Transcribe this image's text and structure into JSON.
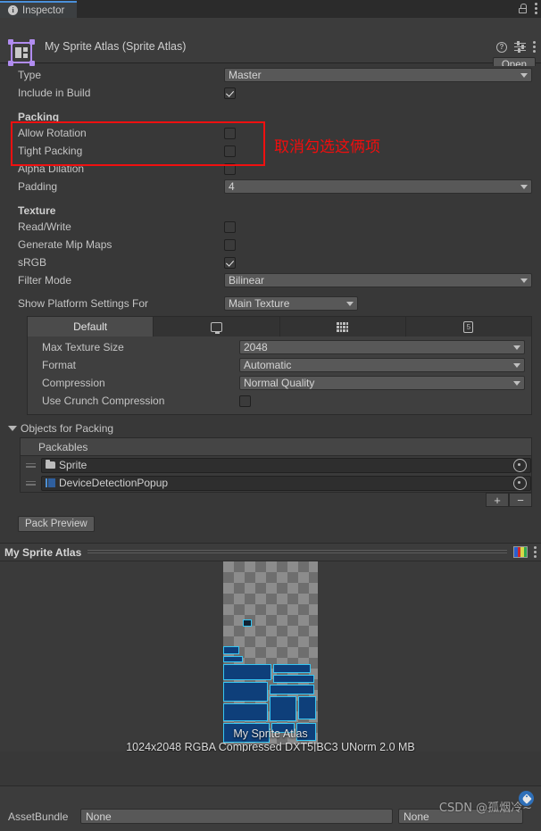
{
  "window": {
    "tab_label": "Inspector",
    "tab_icon": "info-icon",
    "lock_icon": "lock-icon",
    "menu_icon": "kebab-menu-icon"
  },
  "header": {
    "asset_title": "My Sprite Atlas (Sprite Atlas)",
    "asset_icon": "sprite-atlas-icon",
    "help_icon": "help-icon",
    "presets_icon": "presets-icon",
    "menu_icon": "kebab-menu-icon",
    "open_label": "Open"
  },
  "properties": {
    "type_label": "Type",
    "type_value": "Master",
    "include_label": "Include in Build",
    "include_checked": true
  },
  "packing": {
    "section_label": "Packing",
    "rows": [
      {
        "label": "Allow Rotation",
        "checked": false
      },
      {
        "label": "Tight Packing",
        "checked": false
      },
      {
        "label": "Alpha Dilation",
        "checked": false
      }
    ],
    "padding_label": "Padding",
    "padding_value": "4"
  },
  "annotation": {
    "text": "取消勾选这俩项",
    "color": "#f20d0d"
  },
  "texture": {
    "section_label": "Texture",
    "rows": [
      {
        "label": "Read/Write",
        "checked": false
      },
      {
        "label": "Generate Mip Maps",
        "checked": false
      },
      {
        "label": "sRGB",
        "checked": true
      }
    ],
    "filter_label": "Filter Mode",
    "filter_value": "Bilinear",
    "platform_label": "Show Platform Settings For",
    "platform_value": "Main Texture"
  },
  "platform_settings": {
    "tabs": [
      {
        "label": "Default",
        "icon": "",
        "selected": true
      },
      {
        "label": "",
        "icon": "standalone-monitor-icon",
        "selected": false
      },
      {
        "label": "",
        "icon": "android-icon",
        "selected": false
      },
      {
        "label": "",
        "icon": "ios-icon",
        "selected": false
      }
    ],
    "max_size_label": "Max Texture Size",
    "max_size_value": "2048",
    "format_label": "Format",
    "format_value": "Automatic",
    "compression_label": "Compression",
    "compression_value": "Normal Quality",
    "crunch_label": "Use Crunch Compression",
    "crunch_checked": false
  },
  "objects_for_packing": {
    "section_label": "Objects for Packing",
    "column_header": "Packables",
    "items": [
      {
        "name": "Sprite",
        "icon": "folder-icon"
      },
      {
        "name": "DeviceDetectionPopup",
        "icon": "sprite-icon"
      }
    ],
    "add_label": "+",
    "remove_label": "−",
    "pack_preview_label": "Pack Preview"
  },
  "preview": {
    "title": "My Sprite Atlas",
    "channels_icon": "rgb-channels-icon",
    "menu_icon": "kebab-menu-icon",
    "caption": "My Sprite Atlas",
    "status": "1024x2048 RGBA Compressed DXT5|BC3 UNorm   2.0 MB"
  },
  "footer": {
    "tag_icon": "asset-label-icon",
    "assetbundle_label": "AssetBundle",
    "assetbundle_value": "None",
    "variant_value": "None",
    "watermark": "CSDN @孤烟冷~"
  }
}
